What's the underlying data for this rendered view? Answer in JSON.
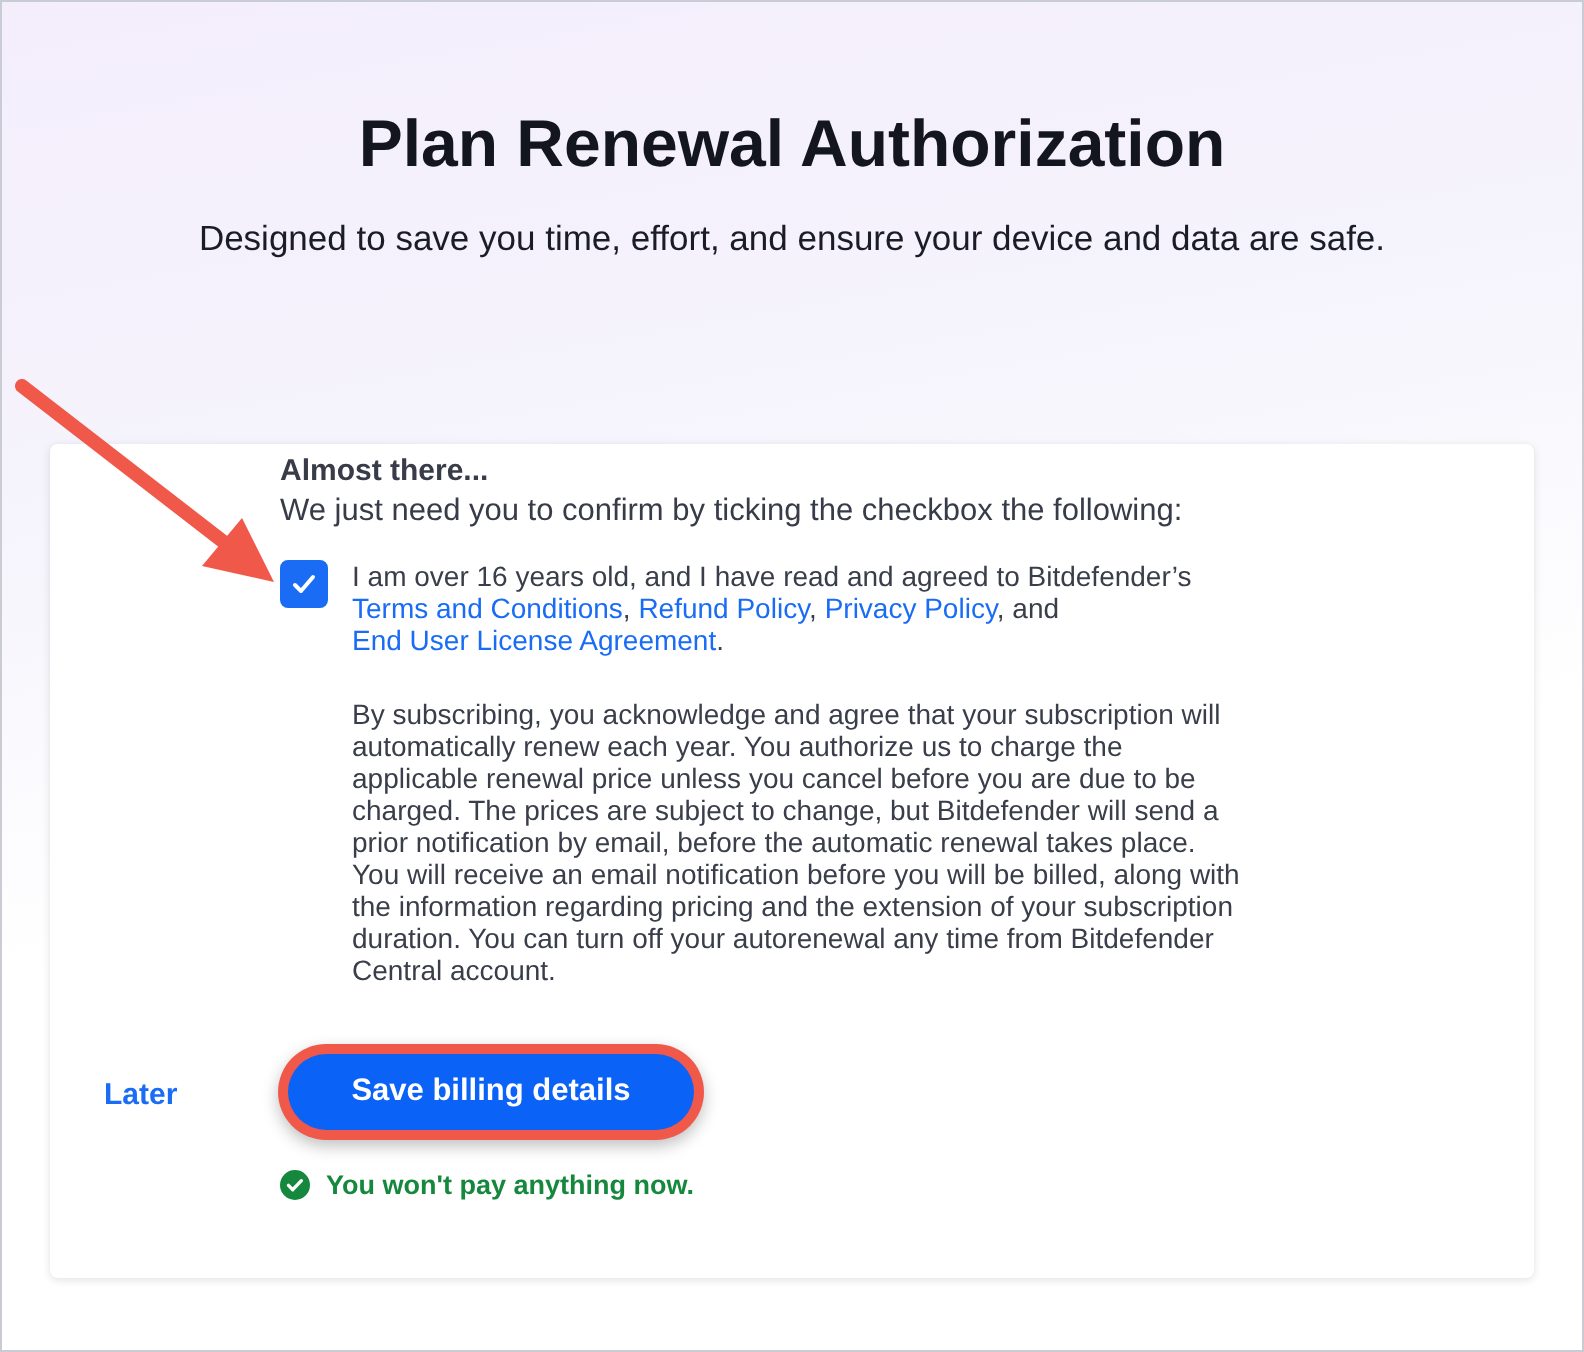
{
  "header": {
    "title": "Plan Renewal Authorization",
    "subtitle": "Designed to save you time, effort, and ensure your device and data are safe."
  },
  "card": {
    "heading": "Almost there...",
    "instruction": "We just need you to confirm by ticking the checkbox the following:",
    "consent": {
      "checked": true,
      "parts": [
        {
          "kind": "text",
          "text": "I am over 16 years old, and I have read and agreed to Bitdefender’s "
        },
        {
          "kind": "link",
          "text": "Terms and Conditions"
        },
        {
          "kind": "text",
          "text": ", "
        },
        {
          "kind": "link",
          "text": "Refund Policy"
        },
        {
          "kind": "text",
          "text": ", "
        },
        {
          "kind": "link",
          "text": "Privacy Policy"
        },
        {
          "kind": "text",
          "text": ", and "
        },
        {
          "kind": "link",
          "text": "End User License Agreement"
        },
        {
          "kind": "text",
          "text": "."
        }
      ]
    },
    "disclaimer": "By subscribing, you acknowledge and agree that your subscription will automatically renew each year. You authorize us to charge the applicable renewal price unless you cancel before you are due to be charged. The prices are subject to change, but Bitdefender will send a prior notification by email, before the automatic renewal takes place. You will receive an email notification before you will be billed, along with the information regarding pricing and the extension of your subscription duration. You can turn off your autorenewal any time from Bitdefender Central account.",
    "later_link": "Later",
    "save_button": "Save billing details",
    "note": "You won't pay anything now."
  },
  "annotations": {
    "arrow": true,
    "button_highlight": true
  }
}
